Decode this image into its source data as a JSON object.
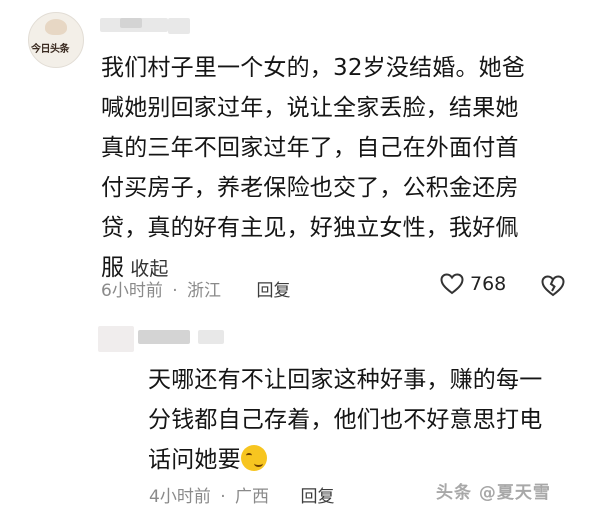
{
  "comment1": {
    "avatar_text": "今日头条",
    "lines": [
      "我们村子里一个女的，32岁没结婚。她爸",
      "喊她别回家过年，说让全家丢脸，结果她",
      "真的三年不回家过年了，自己在外面付首",
      "付买房子，养老保险也交了，公积金还房",
      "贷，真的好有主见，好独立女性，我好佩",
      "服"
    ],
    "collapse_label": "收起",
    "time": "6小时前",
    "separator": "·",
    "location": "浙江",
    "reply_label": "回复",
    "like_count": "768",
    "like_icon": "heart-outline-icon",
    "dislike_icon": "broken-heart-icon"
  },
  "reply1": {
    "lines": [
      "天哪还有不让回家这种好事，赚的每一",
      "分钱都自己存着，他们也不好意思打电",
      "话问她要"
    ],
    "emoji": "smirk-emoji",
    "time": "4小时前",
    "separator": "·",
    "location": "广西",
    "reply_label": "回复"
  },
  "watermark": "头条 @夏天雪"
}
